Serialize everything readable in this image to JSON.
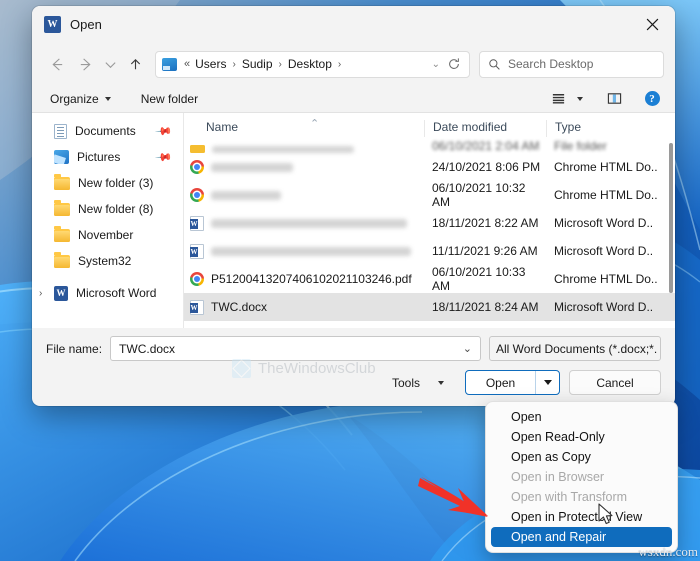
{
  "window": {
    "title": "Open",
    "app_icon": "word-icon",
    "close_label": "✕"
  },
  "nav": {
    "back": "back-arrow-icon",
    "forward": "forward-arrow-icon",
    "recent": "chevron-down-icon",
    "up": "up-arrow-icon",
    "refresh": "refresh-icon",
    "breadcrumb": {
      "prefix": "«",
      "items": [
        "Users",
        "Sudip",
        "Desktop"
      ],
      "separator": "›"
    }
  },
  "search": {
    "placeholder": "Search Desktop",
    "value": ""
  },
  "toolbar": {
    "organize_label": "Organize",
    "new_folder_label": "New folder",
    "view_icon": "list-view-icon",
    "pane_icon": "preview-pane-icon",
    "help_icon": "help-icon",
    "help_glyph": "?"
  },
  "sidebar": {
    "items": [
      {
        "label": "Documents",
        "icon": "documents-icon",
        "pinned": true,
        "expandable": false
      },
      {
        "label": "Pictures",
        "icon": "pictures-icon",
        "pinned": true,
        "expandable": false
      },
      {
        "label": "New folder (3)",
        "icon": "folder-icon",
        "pinned": false,
        "expandable": false
      },
      {
        "label": "New folder (8)",
        "icon": "folder-icon",
        "pinned": false,
        "expandable": false
      },
      {
        "label": "November",
        "icon": "folder-icon",
        "pinned": false,
        "expandable": false
      },
      {
        "label": "System32",
        "icon": "folder-icon",
        "pinned": false,
        "expandable": false
      },
      {
        "label": "Microsoft Word",
        "icon": "word-icon",
        "pinned": false,
        "expandable": true
      }
    ],
    "pin_glyph": "📌",
    "chevron_glyph": "›"
  },
  "filelist": {
    "columns": [
      "Name",
      "Date modified",
      "Type"
    ],
    "sort_indicator": "⌃",
    "rows": [
      {
        "name": "",
        "redacted": true,
        "icon": "folder-icon",
        "date": "06/10/2021 2:04 AM",
        "type": "File folder",
        "selected": false,
        "partial": true
      },
      {
        "name": "",
        "redacted": true,
        "icon": "chrome-icon",
        "date": "24/10/2021 8:06 PM",
        "type": "Chrome HTML Do..",
        "selected": false,
        "partial": false
      },
      {
        "name": "",
        "redacted": true,
        "icon": "chrome-icon",
        "date": "06/10/2021 10:32 AM",
        "type": "Chrome HTML Do..",
        "selected": false,
        "partial": false
      },
      {
        "name": "",
        "redacted": true,
        "icon": "word-file-icon",
        "date": "18/11/2021 8:22 AM",
        "type": "Microsoft Word D..",
        "selected": false,
        "partial": false
      },
      {
        "name": "",
        "redacted": true,
        "icon": "word-file-icon",
        "date": "11/11/2021 9:26 AM",
        "type": "Microsoft Word D..",
        "selected": false,
        "partial": false
      },
      {
        "name": "P51200413207406102021103246.pdf",
        "redacted": false,
        "icon": "chrome-icon",
        "date": "06/10/2021 10:33 AM",
        "type": "Chrome HTML Do..",
        "selected": false,
        "partial": false
      },
      {
        "name": "TWC.docx",
        "redacted": false,
        "icon": "word-file-icon",
        "date": "18/11/2021 8:24 AM",
        "type": "Microsoft Word D..",
        "selected": true,
        "partial": false
      }
    ]
  },
  "bottom": {
    "filename_label": "File name:",
    "filename_value": "TWC.docx",
    "filter_value": "All Word Documents (*.docx;*.",
    "tools_label": "Tools",
    "open_label": "Open",
    "cancel_label": "Cancel",
    "chevron_glyph": "⌄"
  },
  "watermark": {
    "text": "TheWindowsClub",
    "corner_text": "wsxdn.com"
  },
  "menu": {
    "items": [
      {
        "label": "Open",
        "disabled": false,
        "active": false
      },
      {
        "label": "Open Read-Only",
        "disabled": false,
        "active": false
      },
      {
        "label": "Open as Copy",
        "disabled": false,
        "active": false
      },
      {
        "label": "Open in Browser",
        "disabled": true,
        "active": false
      },
      {
        "label": "Open with Transform",
        "disabled": true,
        "active": false
      },
      {
        "label": "Open in Protected View",
        "disabled": false,
        "active": false
      },
      {
        "label": "Open and Repair",
        "disabled": false,
        "active": true
      }
    ]
  },
  "annotation": {
    "arrow_color": "#f03228",
    "arrow_name": "red-pointer-arrow"
  },
  "colors": {
    "accent": "#0f6cbd",
    "window_bg": "#f3f3f3",
    "selection": "#e3e3e3",
    "desktop": "#0b4c9e"
  }
}
